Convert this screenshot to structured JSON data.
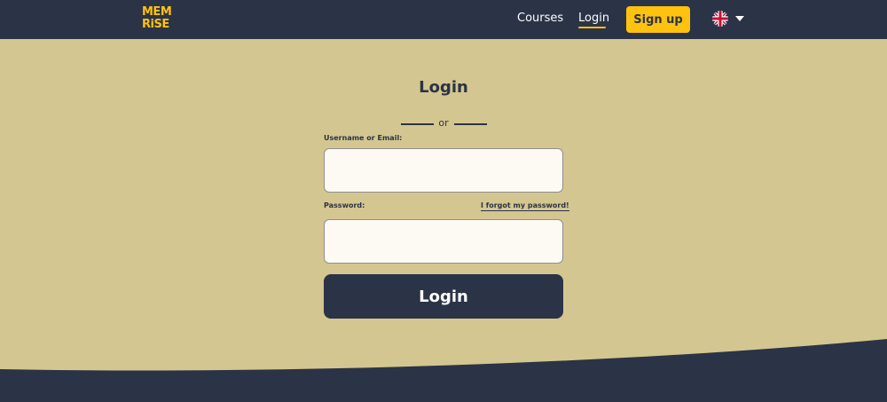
{
  "header": {
    "logo_line1": "MEM",
    "logo_line2": "RiSE",
    "nav": {
      "courses": "Courses",
      "login": "Login"
    },
    "signup_label": "Sign up",
    "language_icon": "uk-flag-icon"
  },
  "form": {
    "title": "Login",
    "divider_text": "or",
    "username_label": "Username or Email:",
    "username_value": "",
    "password_label": "Password:",
    "password_value": "",
    "forgot_label": "I forgot my password!",
    "submit_label": "Login"
  },
  "colors": {
    "navy": "#2b3347",
    "sand": "#d4c690",
    "accent": "#ffc20e",
    "input_bg": "#fdfaf4"
  }
}
